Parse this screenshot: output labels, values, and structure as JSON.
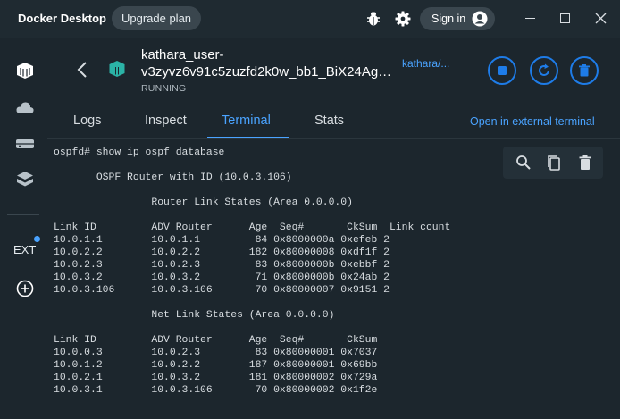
{
  "titlebar": {
    "app_title": "Docker Desktop",
    "upgrade_label": "Upgrade plan",
    "signin_label": "Sign in"
  },
  "sidebar": {
    "items": [
      {
        "icon": "containers-icon"
      },
      {
        "icon": "cloud-icon"
      },
      {
        "icon": "volumes-icon"
      },
      {
        "icon": "dev-environments-icon"
      }
    ],
    "ext_label": "EXT",
    "add_extension_icon": "add-circle-icon"
  },
  "container": {
    "name_line1": "kathara_user-",
    "name_line2": "v3zyvz6v91c5zuzfd2k0w_bb1_BiX24Ag0u...",
    "status": "RUNNING",
    "image_link": "kathara/..."
  },
  "tabs": [
    {
      "label": "Logs",
      "active": false
    },
    {
      "label": "Inspect",
      "active": false
    },
    {
      "label": "Terminal",
      "active": true
    },
    {
      "label": "Stats",
      "active": false
    }
  ],
  "open_external": "Open in external terminal",
  "colors": {
    "accent": "#4aa3ff",
    "button_blue": "#1e7ce8",
    "background": "#1c262d"
  },
  "terminal": {
    "lines": [
      "ospfd# show ip ospf database",
      "",
      "       OSPF Router with ID (10.0.3.106)",
      "",
      "                Router Link States (Area 0.0.0.0)",
      "",
      "Link ID         ADV Router      Age  Seq#       CkSum  Link count",
      "10.0.1.1        10.0.1.1         84 0x8000000a 0xefeb 2",
      "10.0.2.2        10.0.2.2        182 0x80000008 0xdf1f 2",
      "10.0.2.3        10.0.2.3         83 0x8000000b 0xebbf 2",
      "10.0.3.2        10.0.3.2         71 0x8000000b 0x24ab 2",
      "10.0.3.106      10.0.3.106       70 0x80000007 0x9151 2",
      "",
      "                Net Link States (Area 0.0.0.0)",
      "",
      "Link ID         ADV Router      Age  Seq#       CkSum",
      "10.0.0.3        10.0.2.3         83 0x80000001 0x7037",
      "10.0.1.2        10.0.2.2        187 0x80000001 0x69bb",
      "10.0.2.1        10.0.3.2        181 0x80000002 0x729a",
      "10.0.3.1        10.0.3.106       70 0x80000002 0x1f2e"
    ]
  }
}
